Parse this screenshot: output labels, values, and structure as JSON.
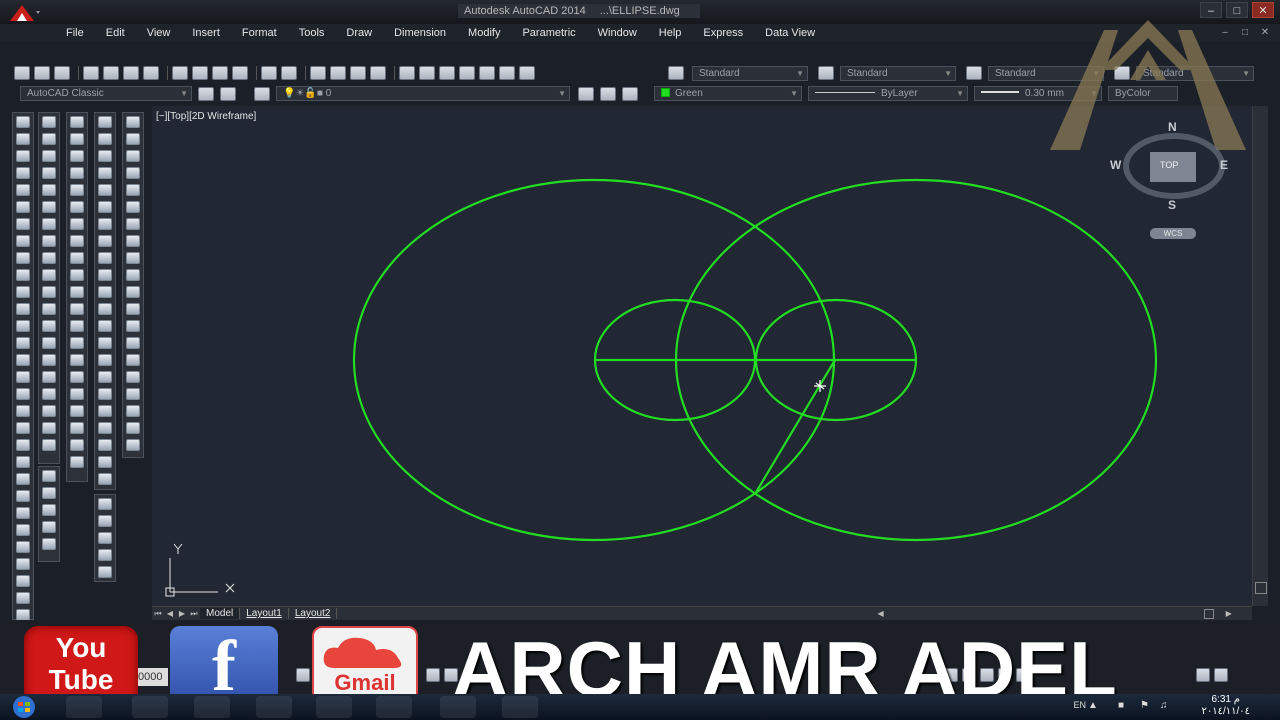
{
  "window": {
    "title": "Autodesk AutoCAD 2014",
    "file": "...\\ELLIPSE.dwg"
  },
  "menu": [
    "File",
    "Edit",
    "View",
    "Insert",
    "Format",
    "Tools",
    "Draw",
    "Dimension",
    "Modify",
    "Parametric",
    "Window",
    "Help",
    "Express",
    "Data View"
  ],
  "toolbar": {
    "text_style": "Standard",
    "dim_style": "Standard",
    "table_style": "Standard",
    "multileader_style": "Standard",
    "workspace": "AutoCAD Classic",
    "layer": "0",
    "color": "Green",
    "linetype": "ByLayer",
    "lineweight": "0.30 mm",
    "plotstyle": "ByColor"
  },
  "viewport": {
    "label": "[−][Top][2D Wireframe]",
    "ucs_x": "X",
    "ucs_y": "Y"
  },
  "viewcube": {
    "north": "N",
    "south": "S",
    "east": "E",
    "west": "W",
    "face": "TOP",
    "wcs": "WCS"
  },
  "tabs": {
    "model": "Model",
    "layout1": "Layout1",
    "layout2": "Layout2"
  },
  "status": {
    "coordinates": "0000"
  },
  "watermark": {
    "youtube_top": "You",
    "youtube_bottom": "Tube",
    "facebook": "f",
    "gmail": "Gmail",
    "banner": "ARCH AMR ADEL"
  },
  "taskbar": {
    "lang": "EN",
    "time": "6:31 م",
    "date": "٢٠١٤/١١/٠٤"
  },
  "colors": {
    "drawing_bg": "#212733",
    "geometry": "#22dd22"
  }
}
